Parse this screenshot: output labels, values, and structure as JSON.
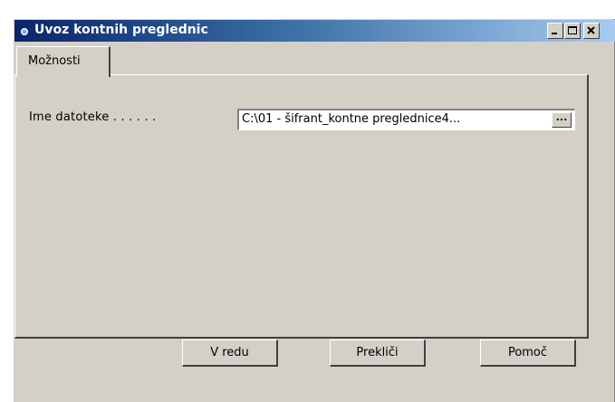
{
  "window": {
    "title": "Uvoz kontnih preglednic"
  },
  "titlebar_buttons": [
    "minimize-icon",
    "maximize-icon",
    "close-icon"
  ],
  "tabs": [
    {
      "label": "Možnosti",
      "selected": true
    }
  ],
  "form": {
    "file_label": "Ime datoteke . . . . . .",
    "file_value": "C:\\01 - šifrant_kontne preglednice4...",
    "browse_label": "..."
  },
  "buttons": {
    "ok": "V redu",
    "cancel": "Prekliči",
    "help": "Pomoč"
  },
  "colors": {
    "titlebar_start": "#0a246a",
    "titlebar_end": "#a6caf0",
    "face": "#d4d0c8"
  }
}
